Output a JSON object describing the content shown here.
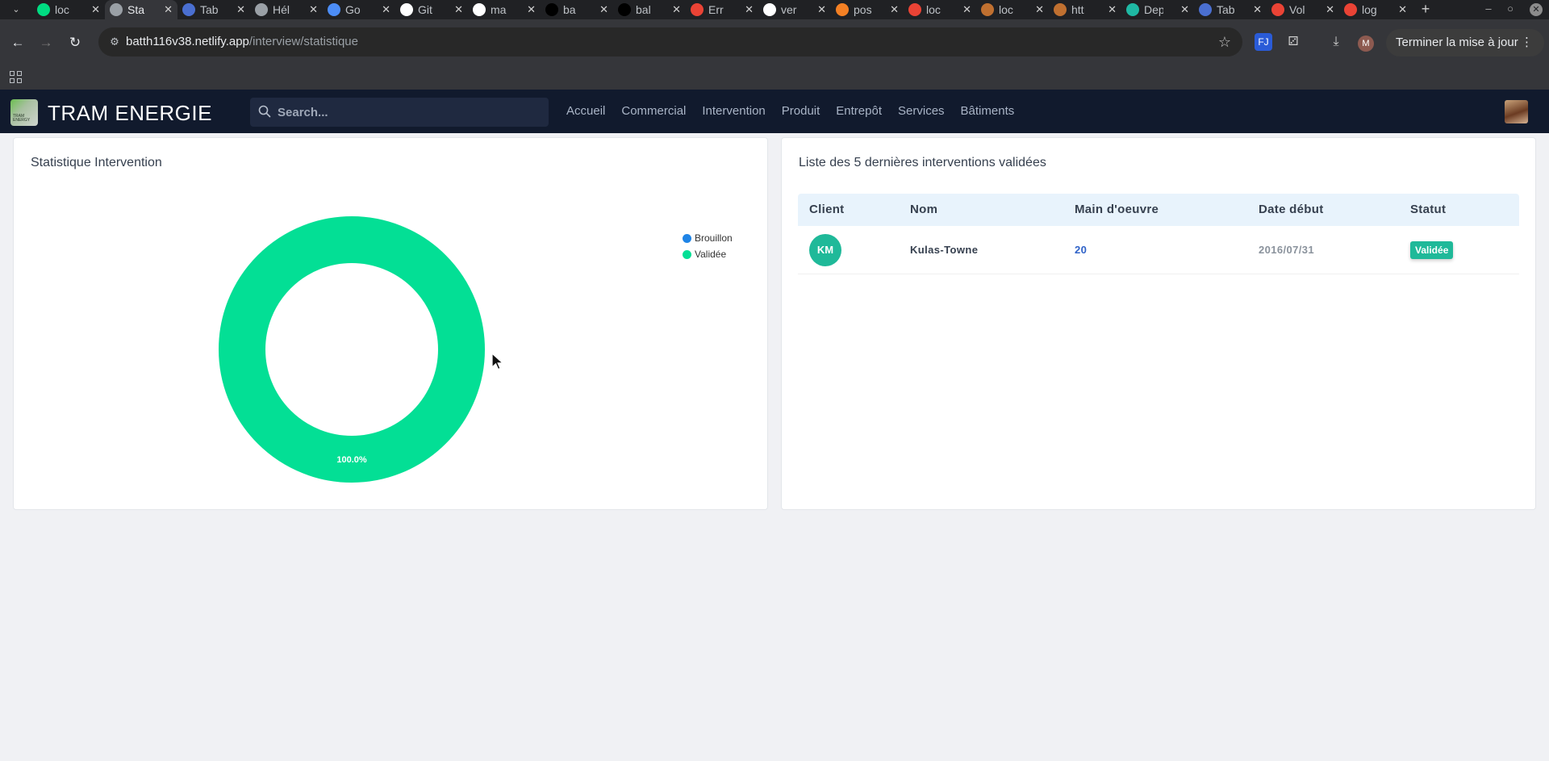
{
  "browser": {
    "tabs": [
      {
        "title": "loc",
        "icon": "nuxt-icon",
        "color": "#00dc82"
      },
      {
        "title": "Sta",
        "icon": "globe-icon",
        "color": "#9aa0a6",
        "active": true
      },
      {
        "title": "Tab",
        "icon": "tableau-icon",
        "color": "#4a6fd1"
      },
      {
        "title": "Hél",
        "icon": "openai-icon",
        "color": "#9aa0a6"
      },
      {
        "title": "Go",
        "icon": "gemini-icon",
        "color": "#4c8df6"
      },
      {
        "title": "Git",
        "icon": "github-icon",
        "color": "#ffffff"
      },
      {
        "title": "ma",
        "icon": "github-icon",
        "color": "#ffffff"
      },
      {
        "title": "ba",
        "icon": "vercel-icon",
        "color": "#000000"
      },
      {
        "title": "bal",
        "icon": "vercel-icon",
        "color": "#000000"
      },
      {
        "title": "Err",
        "icon": "google-icon",
        "color": "#ea4335"
      },
      {
        "title": "ver",
        "icon": "github-icon",
        "color": "#ffffff"
      },
      {
        "title": "pos",
        "icon": "stackoverflow-icon",
        "color": "#f48024"
      },
      {
        "title": "loc",
        "icon": "google-icon",
        "color": "#ea4335"
      },
      {
        "title": "loc",
        "icon": "laravel-icon",
        "color": "#c07030"
      },
      {
        "title": "htt",
        "icon": "laravel-icon",
        "color": "#c07030"
      },
      {
        "title": "Dep",
        "icon": "diamond-icon",
        "color": "#1fb9a4"
      },
      {
        "title": "Tab",
        "icon": "tableau-icon",
        "color": "#4a6fd1"
      },
      {
        "title": "Vol",
        "icon": "gmail-icon",
        "color": "#ea4335"
      },
      {
        "title": "log",
        "icon": "google-icon",
        "color": "#ea4335"
      }
    ],
    "url_host": "batth116v38.netlify.app",
    "url_path": "/interview/statistique",
    "update_label": "Terminer la mise à jour",
    "profile_initial": "M"
  },
  "app": {
    "brand": "TRAM ENERGIE",
    "logo_text": "TRAM ENERGY",
    "search_placeholder": "Search...",
    "nav": [
      "Accueil",
      "Commercial",
      "Intervention",
      "Produit",
      "Entrepôt",
      "Services",
      "Bâtiments"
    ]
  },
  "stats_card": {
    "title": "Statistique Intervention"
  },
  "chart_data": {
    "type": "pie",
    "variant": "doughnut",
    "labels": [
      "Brouillon",
      "Validée"
    ],
    "values": [
      0,
      100
    ],
    "colors": [
      "#1f84e6",
      "#03df95"
    ],
    "data_labels": [
      "",
      "100.0%"
    ],
    "legend": "top-right"
  },
  "table_card": {
    "title": "Liste des 5 dernières interventions validées",
    "columns": [
      "Client",
      "Nom",
      "Main d'oeuvre",
      "Date début",
      "Statut"
    ],
    "rows": [
      {
        "initials": "KM",
        "initials_color": "#1fb999",
        "nom": "Kulas-Towne",
        "main_oeuvre": "20",
        "date_debut": "2016/07/31",
        "statut": "Validée",
        "statut_color": "#1fb999"
      }
    ]
  }
}
